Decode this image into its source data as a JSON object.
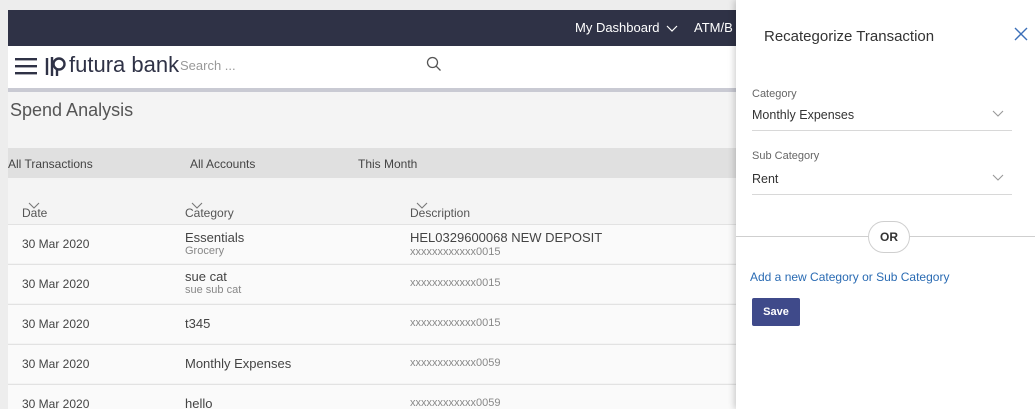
{
  "topnav": {
    "dashboard_label": "My Dashboard",
    "atm_label": "ATM/B"
  },
  "brand": {
    "name": "futura bank"
  },
  "search": {
    "placeholder": "Search ..."
  },
  "page": {
    "title": "Spend Analysis"
  },
  "filters": [
    "All Transactions",
    "All Accounts",
    "This Month"
  ],
  "table": {
    "headers": {
      "date": "Date",
      "category": "Category",
      "description": "Description"
    },
    "rows": [
      {
        "date": "30 Mar 2020",
        "category": "Essentials",
        "subcategory": "Grocery",
        "desc": "HEL0329600068 NEW DEPOSIT",
        "account": "xxxxxxxxxxxx0015"
      },
      {
        "date": "30 Mar 2020",
        "category": "sue cat",
        "subcategory": "sue sub cat",
        "desc": "",
        "account": "xxxxxxxxxxxx0015"
      },
      {
        "date": "30 Mar 2020",
        "category": "t345",
        "subcategory": "",
        "desc": "",
        "account": "xxxxxxxxxxxx0015"
      },
      {
        "date": "30 Mar 2020",
        "category": "Monthly Expenses",
        "subcategory": "",
        "desc": "",
        "account": "xxxxxxxxxxxx0059"
      },
      {
        "date": "30 Mar 2020",
        "category": "hello",
        "subcategory": "",
        "desc": "",
        "account": "xxxxxxxxxxxx0059"
      }
    ]
  },
  "panel": {
    "title": "Recategorize Transaction",
    "category_label": "Category",
    "category_value": "Monthly Expenses",
    "subcategory_label": "Sub Category",
    "subcategory_value": "Rent",
    "or_label": "OR",
    "add_link": "Add a new Category or Sub Category",
    "save_label": "Save"
  },
  "colors": {
    "header_bg": "#2f3246",
    "primary_button": "#3f4a8a",
    "link": "#2a6bb3"
  },
  "icons": [
    "hamburger-menu-icon",
    "futura-logo-icon",
    "search-icon",
    "chevron-down-icon",
    "close-icon"
  ]
}
